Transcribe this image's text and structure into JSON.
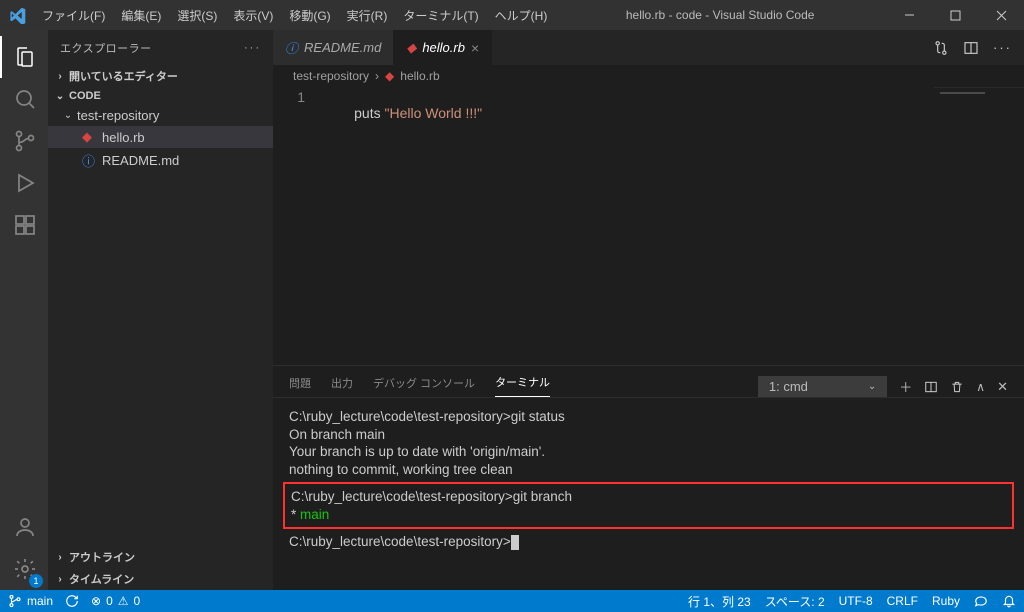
{
  "titlebar": {
    "menus": [
      "ファイル(F)",
      "編集(E)",
      "選択(S)",
      "表示(V)",
      "移動(G)",
      "実行(R)",
      "ターミナル(T)",
      "ヘルプ(H)"
    ],
    "title": "hello.rb - code - Visual Studio Code"
  },
  "sidebar": {
    "header": "エクスプローラー",
    "open_editors": "開いているエディター",
    "workspace": "CODE",
    "folder": "test-repository",
    "files": [
      {
        "name": "hello.rb",
        "type": "ruby",
        "selected": true
      },
      {
        "name": "README.md",
        "type": "info",
        "selected": false
      }
    ],
    "outline": "アウトライン",
    "timeline": "タイムライン"
  },
  "tabs": [
    {
      "name": "README.md",
      "active": false,
      "icon": "info"
    },
    {
      "name": "hello.rb",
      "active": true,
      "icon": "ruby"
    }
  ],
  "breadcrumb": {
    "folder": "test-repository",
    "file": "hello.rb"
  },
  "editor": {
    "line_number": "1",
    "keyword": "puts",
    "string": " \"Hello World !!!\""
  },
  "panel": {
    "tabs": [
      "問題",
      "出力",
      "デバッグ コンソール",
      "ターミナル"
    ],
    "active": 3,
    "term_selector": "1: cmd",
    "lines_before": [
      "C:\\ruby_lecture\\code\\test-repository>git status",
      "On branch main",
      "Your branch is up to date with 'origin/main'.",
      "",
      "nothing to commit, working tree clean"
    ],
    "highlight": [
      "C:\\ruby_lecture\\code\\test-repository>git branch",
      "* main"
    ],
    "prompt": "C:\\ruby_lecture\\code\\test-repository>"
  },
  "statusbar": {
    "branch": "main",
    "sync": "",
    "errors": "0",
    "warnings": "0",
    "ln": "行 1、列 23",
    "spaces": "スペース: 2",
    "encoding": "UTF-8",
    "eol": "CRLF",
    "lang": "Ruby"
  }
}
